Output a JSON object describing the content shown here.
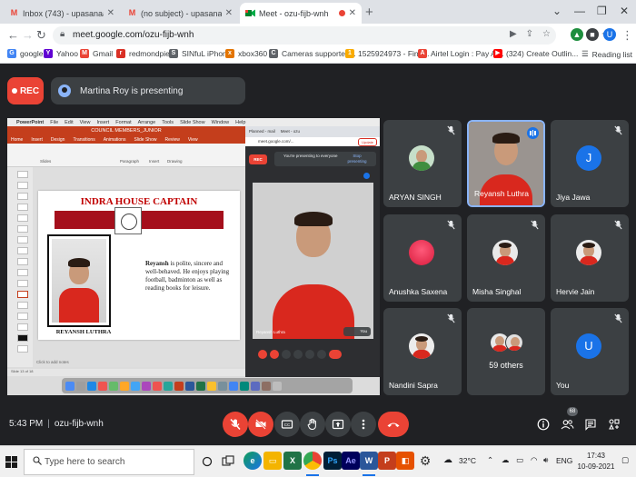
{
  "browser": {
    "tabs": [
      {
        "title": "Inbox (743) - upasanaa@theindi",
        "favicon": "gmail-icon",
        "active": false
      },
      {
        "title": "(no subject) - upasanaabhalla13@",
        "favicon": "gmail-icon",
        "active": false
      },
      {
        "title": "Meet - ozu-fijb-wnh",
        "favicon": "meet-icon",
        "active": true
      }
    ],
    "new_tab": "+",
    "url": "meet.google.com/ozu-fijb-wnh",
    "profile_initial": "U",
    "bookmarks": [
      {
        "label": "google",
        "color": "#4285f4",
        "glyph": "G"
      },
      {
        "label": "Yahoo",
        "color": "#6001d2",
        "glyph": "Y"
      },
      {
        "label": "Gmail",
        "color": "#ea4335",
        "glyph": "M"
      },
      {
        "label": "redmondpie",
        "color": "#d93025",
        "glyph": "r"
      },
      {
        "label": "SINfuL iPhone",
        "color": "#5f6368",
        "glyph": "S"
      },
      {
        "label": "xbox360",
        "color": "#e37400",
        "glyph": "x"
      },
      {
        "label": "Cameras supported...",
        "color": "#5f6368",
        "glyph": "C"
      },
      {
        "label": "1525924973 - Find...",
        "color": "#f9ab00",
        "glyph": "1"
      },
      {
        "label": "Airtel Login : Pay Ai...",
        "color": "#ea4335",
        "glyph": "A"
      },
      {
        "label": "(324) Create Outlin...",
        "color": "#ff0000",
        "glyph": "▶"
      }
    ],
    "reading_list": "Reading list"
  },
  "meet": {
    "rec_label": "REC",
    "presenter_text": "Martina Roy is presenting",
    "meeting_time": "5:43 PM",
    "meeting_code": "ozu-fijb-wnh",
    "participant_count": "68",
    "participants": [
      {
        "name": "ARYAN SINGH",
        "avatar": "photo",
        "muted": true,
        "speaking": false
      },
      {
        "name": "Reyansh Luthra",
        "avatar": "video",
        "muted": false,
        "speaking": true
      },
      {
        "name": "Jiya Jawa",
        "avatar": "J",
        "avatar_color": "#1a73e8",
        "muted": true,
        "speaking": false
      },
      {
        "name": "Anushka Saxena",
        "avatar": "photo",
        "muted": true,
        "speaking": false
      },
      {
        "name": "Misha Singhal",
        "avatar": "photo",
        "muted": true,
        "speaking": false
      },
      {
        "name": "Hervie Jain",
        "avatar": "photo",
        "muted": true,
        "speaking": false
      },
      {
        "name": "Nandini Sapra",
        "avatar": "photo",
        "muted": true,
        "speaking": false
      },
      {
        "name": "59 others",
        "avatar": "group",
        "muted": false,
        "speaking": false
      },
      {
        "name": "You",
        "avatar": "U",
        "avatar_color": "#1a73e8",
        "muted": true,
        "speaking": false
      }
    ]
  },
  "shared_screen": {
    "ppt_menu": [
      "PowerPoint",
      "File",
      "Edit",
      "View",
      "Insert",
      "Format",
      "Arrange",
      "Tools",
      "Slide Show",
      "Window",
      "Help"
    ],
    "ppt_file": "COUNCIL MEMBERS_JUNIOR",
    "ppt_tabs": [
      "Home",
      "Insert",
      "Design",
      "Transitions",
      "Animations",
      "Slide Show",
      "Review",
      "View"
    ],
    "ribbon_groups": [
      "Slides",
      "Paragraph",
      "Insert",
      "Drawing"
    ],
    "slide_title": "INDRA HOUSE CAPTAIN",
    "slide_name_bold": "Reyansh",
    "slide_body": " is polite, sincere and well-behaved. He enjoys playing football, badminton as well as reading books for leisure.",
    "slide_caption": "REYANSH LUTHRA",
    "notes_placeholder": "Click to add notes",
    "slide_count": "Slide 13 of 18",
    "mini_url": "meet.google.com/...",
    "mini_update": "Update",
    "mini_rec": "REC",
    "mini_presenting": "You're presenting to everyone",
    "mini_stop": "Stop presenting",
    "mini_video_name": "Reyansh Luthra",
    "mini_you": "You"
  },
  "taskbar": {
    "search_placeholder": "Type here to search",
    "weather": "32°C",
    "language": "ENG",
    "time": "17:43",
    "date": "10-09-2021"
  }
}
